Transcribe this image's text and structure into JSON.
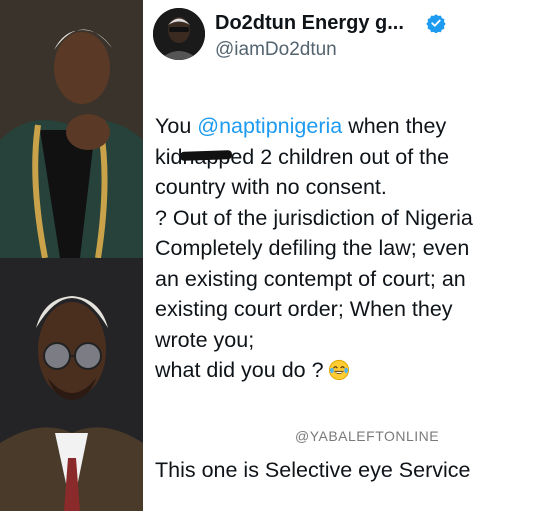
{
  "photos": {
    "top_alt": "man-in-green-jacket-photo",
    "bottom_alt": "man-with-glasses-photo"
  },
  "tweet": {
    "display_name": "Do2dtun Energy g...",
    "handle": "@iamDo2dtun",
    "verified": true,
    "accent_color": "#1d9bf0",
    "body": {
      "line1_prefix": "You ",
      "line1_mention": "@naptipnigeria",
      "line1_suffix": " when they",
      "line2_pre": "kid",
      "line2_scribbled": "napp",
      "line2_post": "ed 2 children out of the",
      "line3": "country with no consent.",
      "line4": "? Out of the jurisdiction of Nigeria",
      "line5": "Completely defiling the law; even",
      "line6": "an existing contempt of court; an",
      "line7": "existing court order; When they",
      "line8": "wrote you;",
      "line9": "what did you do ?",
      "line9_emoji": "tears-of-joy-emoji-icon"
    },
    "watermark": "@YABALEFTONLINE",
    "caption": "This one is Selective eye Service"
  }
}
